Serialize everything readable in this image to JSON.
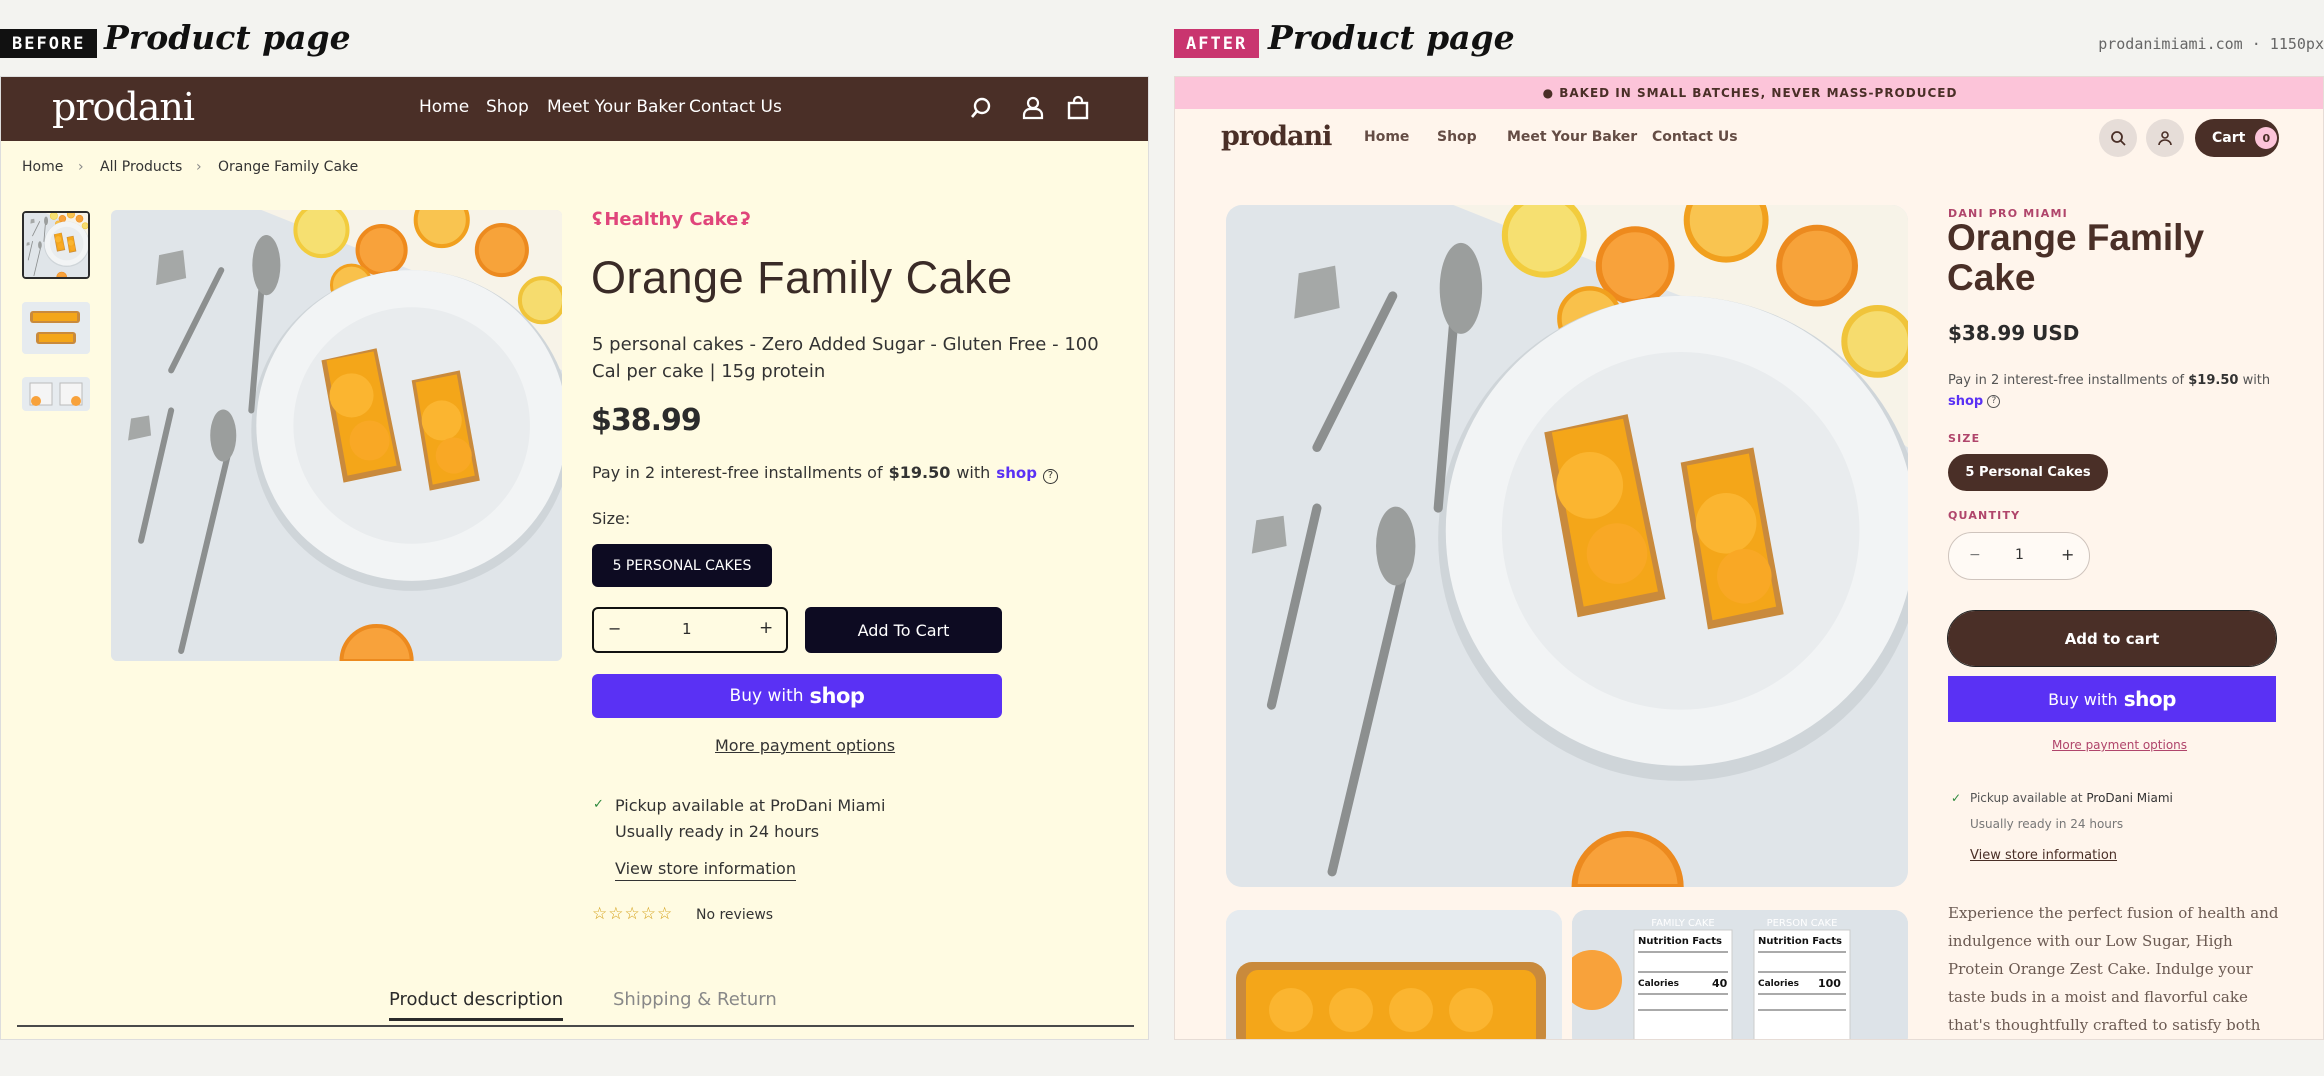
{
  "before": {
    "badge": "BEFORE",
    "title": "Product page",
    "logo": "prodani",
    "nav": [
      "Home",
      "Shop",
      "Meet Your Baker",
      "Contact Us"
    ],
    "breadcrumb": [
      "Home",
      "All Products",
      "Orange Family Cake"
    ],
    "tag": "Healthy Cake",
    "product_title": "Orange Family Cake",
    "subtitle": "5 personal cakes - Zero Added Sugar - Gluten Free - 100 Cal per cake | 15g protein",
    "price": "$38.99",
    "installments_prefix": "Pay in 2 interest-free installments of",
    "installments_amount": "$19.50",
    "installments_with": "with",
    "shop_word": "shop",
    "size_label": "Size:",
    "size_value": "5 PERSONAL CAKES",
    "qty_minus": "−",
    "quantity": "1",
    "qty_plus": "+",
    "add_to_cart": "Add To Cart",
    "buy_with": "Buy with",
    "more_payment": "More payment options",
    "pickup_line": "Pickup available at ProDani Miami",
    "ready_line": "Usually ready in 24 hours",
    "store_info": "View store information",
    "reviews": "No reviews",
    "tabs": [
      "Product description",
      "Shipping & Return"
    ],
    "rating": 0,
    "colors": {
      "header": "#4a2f27",
      "background": "#fffbe2",
      "button": "#0d0b22",
      "shop_pay": "#5a31f4",
      "accent": "#e0457b"
    }
  },
  "after": {
    "badge": "AFTER",
    "title": "Product page",
    "viewport": "prodanimiami.com · 1150px",
    "banner": "● BAKED IN SMALL BATCHES, NEVER MASS-PRODUCED",
    "logo": "prodani",
    "nav": [
      "Home",
      "Shop",
      "Meet Your Baker",
      "Contact Us"
    ],
    "cart_label": "Cart",
    "cart_count": "0",
    "vendor": "DANI PRO MIAMI",
    "product_title": "Orange Family Cake",
    "price": "$38.99 USD",
    "installments_prefix": "Pay in 2 interest-free installments of",
    "installments_amount": "$19.50",
    "installments_with": "with",
    "shop_word": "shop",
    "size_label": "SIZE",
    "size_value": "5 Personal Cakes",
    "quantity_label": "QUANTITY",
    "qty_minus": "−",
    "quantity": "1",
    "qty_plus": "+",
    "add_to_cart": "Add to cart",
    "buy_with": "Buy with",
    "more_payment": "More payment options",
    "pickup_prefix": "Pickup available at",
    "pickup_store": "ProDani Miami",
    "ready_line": "Usually ready in 24 hours",
    "store_info": "View store information",
    "description": "Experience the perfect fusion of health and indulgence with our Low Sugar, High Protein Orange Zest Cake. Indulge your taste buds in a moist and flavorful cake that's thoughtfully crafted to satisfy both your",
    "label_family": "FAMILY CAKE",
    "label_person": "PERSON CAKE",
    "nutrition_title": "Nutrition Facts",
    "calories_label": "Calories",
    "calories_family": "40",
    "calories_person": "100",
    "colors": {
      "banner": "#fcc4d9",
      "background": "#fff5ec",
      "brand": "#4a2f27",
      "shop_pay": "#5a31f4",
      "accent": "#b0456b"
    }
  }
}
